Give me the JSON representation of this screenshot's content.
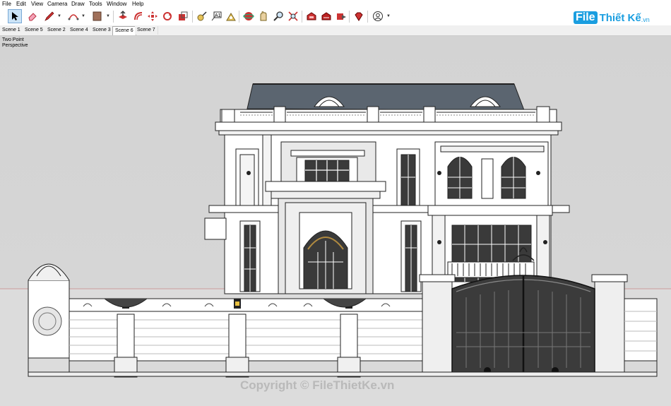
{
  "menu": [
    "File",
    "Edit",
    "View",
    "Camera",
    "Draw",
    "Tools",
    "Window",
    "Help"
  ],
  "toolbar": {
    "tools": [
      "select-icon",
      "eraser-icon",
      "pencil-icon",
      "arc-icon",
      "paint-bucket-icon",
      "push-pull-icon",
      "offset-icon",
      "move-icon",
      "rotate-icon",
      "scale-icon",
      "tape-measure-icon",
      "text-icon",
      "dimension-icon",
      "orbit-icon",
      "pan-icon",
      "zoom-icon",
      "zoom-extents-icon",
      "warehouse-icon",
      "extension-icon",
      "send-icon",
      "ruby-icon",
      "account-icon"
    ]
  },
  "logo": {
    "file": "File",
    "rest": "Thiết Kế",
    "vn": ".vn"
  },
  "scenes": [
    "Scene 1",
    "Scene 5",
    "Scene 2",
    "Scene 4",
    "Scene 3",
    "Scene 6",
    "Scene 7"
  ],
  "active_scene": "Scene 6",
  "camera_label": {
    "line1": "Two Point",
    "line2": "Perspective"
  },
  "watermark": "Copyright © FileThietKe.vn",
  "colors": {
    "accent": "#1a9ee0",
    "roof": "#5b6570",
    "gate": "#222222",
    "sky": "#d3d3d3"
  }
}
